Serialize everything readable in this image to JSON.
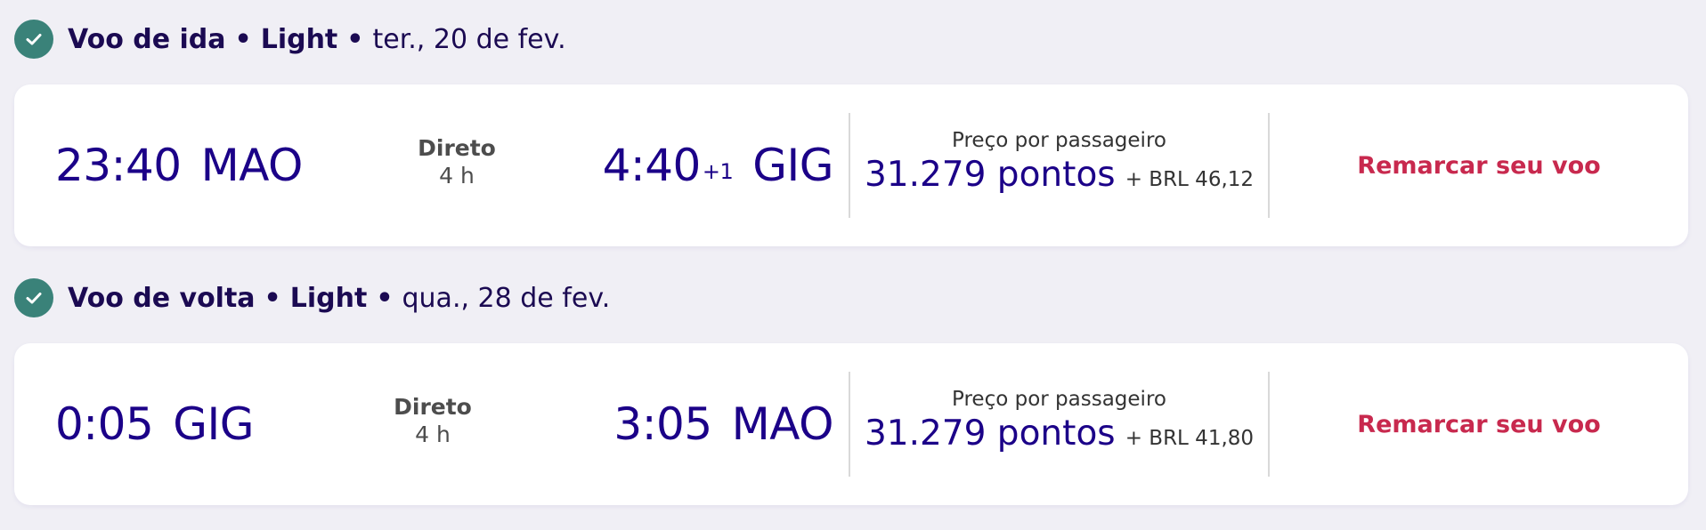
{
  "outbound": {
    "header": {
      "leg": "Voo de ida",
      "fare": "Light",
      "date": "ter., 20 de fev."
    },
    "departure": {
      "time": "23:40",
      "airport": "MAO"
    },
    "stops": "Direto",
    "duration": "4 h",
    "arrival": {
      "time": "4:40",
      "day_offset": "+1",
      "airport": "GIG"
    },
    "price_label": "Preço por passageiro",
    "points": "31.279 pontos",
    "taxes": "+ BRL 46,12",
    "action_label": "Remarcar seu voo"
  },
  "return": {
    "header": {
      "leg": "Voo de volta",
      "fare": "Light",
      "date": "qua., 28 de fev."
    },
    "departure": {
      "time": "0:05",
      "airport": "GIG"
    },
    "stops": "Direto",
    "duration": "4 h",
    "arrival": {
      "time": "3:05",
      "airport": "MAO"
    },
    "price_label": "Preço por passageiro",
    "points": "31.279 pontos",
    "taxes": "+ BRL 41,80",
    "action_label": "Remarcar seu voo"
  },
  "colors": {
    "background": "#f0eff5",
    "card": "#ffffff",
    "primary_text": "#1b0088",
    "check_badge": "#3a8279",
    "action": "#c8294e"
  },
  "icons": {
    "status": "check-circle-icon"
  }
}
